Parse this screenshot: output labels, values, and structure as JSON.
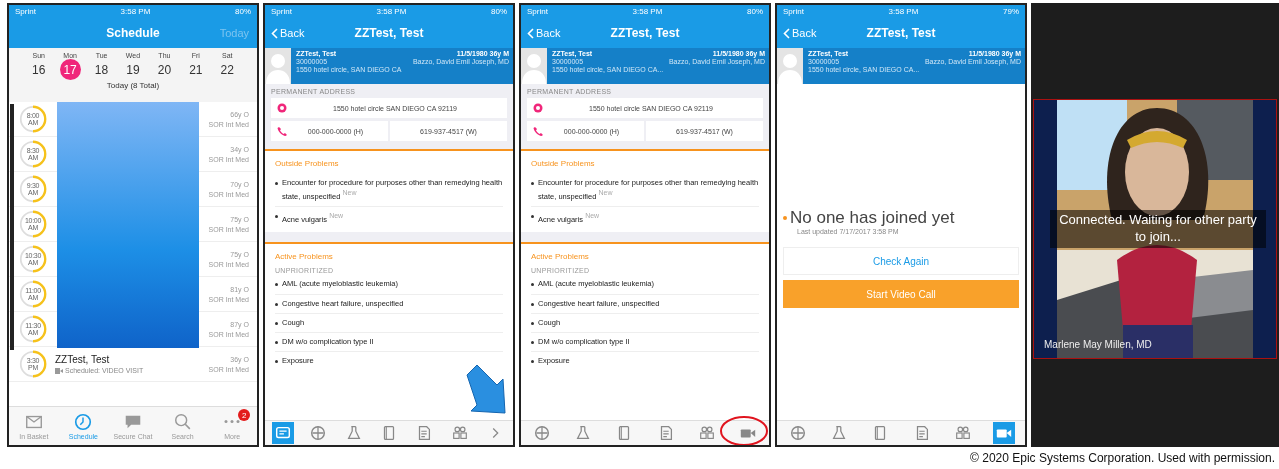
{
  "panels": [
    {
      "kind": "schedule",
      "status": {
        "carrier": "Sprint",
        "time": "3:58 PM",
        "battery": "80%"
      },
      "title": "Schedule",
      "action": "Today",
      "days": [
        {
          "dow": "Sun",
          "date": "16",
          "selected": false
        },
        {
          "dow": "Mon",
          "date": "17",
          "selected": true
        },
        {
          "dow": "Tue",
          "date": "18",
          "selected": false
        },
        {
          "dow": "Wed",
          "date": "19",
          "selected": false
        },
        {
          "dow": "Thu",
          "date": "20",
          "selected": false
        },
        {
          "dow": "Fri",
          "date": "21",
          "selected": false
        },
        {
          "dow": "Sat",
          "date": "22",
          "selected": false
        }
      ],
      "summary": "Today (8 Total)",
      "redacted": true,
      "appointments": [
        {
          "time": "8:00",
          "ampm": "AM",
          "age": "66y O",
          "dept": "SOR Int Med"
        },
        {
          "time": "8:30",
          "ampm": "AM",
          "age": "34y O",
          "dept": "SOR Int Med"
        },
        {
          "time": "9:30",
          "ampm": "AM",
          "age": "70y O",
          "dept": "SOR Int Med"
        },
        {
          "time": "10:00",
          "ampm": "AM",
          "age": "75y O",
          "dept": "SOR Int Med"
        },
        {
          "time": "10:30",
          "ampm": "AM",
          "age": "75y O",
          "dept": "SOR Int Med"
        },
        {
          "time": "11:00",
          "ampm": "AM",
          "age": "81y O",
          "dept": "SOR Int Med"
        },
        {
          "time": "11:30",
          "ampm": "AM",
          "age": "87y O",
          "dept": "SOR Int Med"
        },
        {
          "time": "3:30",
          "ampm": "PM",
          "name": "ZZTest, Test",
          "note": "Scheduled: VIDEO VISIT",
          "age": "36y O",
          "dept": "SOR Int Med"
        }
      ],
      "tabs": [
        {
          "kind": "inbox",
          "label": "In Basket",
          "selected": false
        },
        {
          "kind": "clock",
          "label": "Schedule",
          "selected": true
        },
        {
          "kind": "chat",
          "label": "Secure Chat",
          "selected": false
        },
        {
          "kind": "search",
          "label": "Search",
          "selected": false
        },
        {
          "kind": "more",
          "label": "More",
          "selected": false,
          "badge": "2"
        }
      ]
    },
    {
      "kind": "patient",
      "annotation": {
        "kind": "arrow"
      },
      "status": {
        "carrier": "Sprint",
        "time": "3:58 PM",
        "battery": "80%"
      },
      "back": "Back",
      "title": "ZZTest, Test",
      "patient": {
        "name": "ZZTest, Test",
        "dob": "11/5/1980 36y M",
        "mrn": "30000005",
        "provider": "Bazzo, David Emil Joseph, MD",
        "address": "1550 hotel circle, SAN DIEGO CA"
      },
      "address_label": "PERMANENT ADDRESS",
      "address": "1550 hotel circle SAN DIEGO CA 92119",
      "phone_home": "000-000-0000 (H)",
      "phone_work": "619-937-4517 (W)",
      "outside_title": "Outside Problems",
      "outside": [
        {
          "text": "Encounter for procedure for purposes other than remedying health state, unspecified",
          "tag": "New"
        },
        {
          "text": "Acne vulgaris",
          "tag": "New"
        }
      ],
      "active_title": "Active Problems",
      "active_label": "UNPRIORITIZED",
      "active": [
        "AML (acute myeloblastic leukemia)",
        "Congestive heart failure, unspecified",
        "Cough",
        "DM w/o complication type II",
        "Exposure"
      ],
      "toolbar": [
        {
          "kind": "summary",
          "selected": true
        },
        {
          "kind": "chart",
          "selected": false
        },
        {
          "kind": "labs",
          "selected": false
        },
        {
          "kind": "notes",
          "selected": false
        },
        {
          "kind": "documents",
          "selected": false
        },
        {
          "kind": "team",
          "selected": false
        },
        {
          "kind": "more",
          "selected": false
        }
      ]
    },
    {
      "kind": "patient",
      "annotation": {
        "kind": "ellipse"
      },
      "status": {
        "carrier": "Sprint",
        "time": "3:58 PM",
        "battery": "80%"
      },
      "back": "Back",
      "title": "ZZTest, Test",
      "patient": {
        "name": "ZZTest, Test",
        "dob": "11/5/1980 36y M",
        "mrn": "30000005",
        "provider": "Bazzo, David Emil Joseph, MD",
        "address": "1550 hotel circle, SAN DIEGO CA..."
      },
      "address_label": "PERMANENT ADDRESS",
      "address": "1550 hotel circle SAN DIEGO CA 92119",
      "phone_home": "000-000-0000 (H)",
      "phone_work": "619-937-4517 (W)",
      "outside_title": "Outside Problems",
      "outside": [
        {
          "text": "Encounter for procedure for purposes other than remedying health state, unspecified",
          "tag": "New"
        },
        {
          "text": "Acne vulgaris",
          "tag": "New"
        }
      ],
      "active_title": "Active Problems",
      "active_label": "UNPRIORITIZED",
      "active": [
        "AML (acute myeloblastic leukemia)",
        "Congestive heart failure, unspecified",
        "Cough",
        "DM w/o complication type II",
        "Exposure"
      ],
      "toolbar": [
        {
          "kind": "chart",
          "selected": false
        },
        {
          "kind": "labs",
          "selected": false
        },
        {
          "kind": "notes",
          "selected": false
        },
        {
          "kind": "documents",
          "selected": false
        },
        {
          "kind": "team",
          "selected": false
        },
        {
          "kind": "video",
          "selected": false
        }
      ]
    },
    {
      "kind": "waiting",
      "status": {
        "carrier": "Sprint",
        "time": "3:58 PM",
        "battery": "79%"
      },
      "back": "Back",
      "title": "ZZTest, Test",
      "patient": {
        "name": "ZZTest, Test",
        "dob": "11/5/1980 36y M",
        "mrn": "30000005",
        "provider": "Bazzo, David Emil Joseph, MD",
        "address": "1550 hotel circle, SAN DIEGO CA..."
      },
      "message": "No one has joined yet",
      "updated": "Last updated 7/17/2017 3:58 PM",
      "check_button": "Check Again",
      "start_button": "Start Video Call",
      "toolbar": [
        {
          "kind": "chart",
          "selected": false
        },
        {
          "kind": "labs",
          "selected": false
        },
        {
          "kind": "notes",
          "selected": false
        },
        {
          "kind": "documents",
          "selected": false
        },
        {
          "kind": "team",
          "selected": false
        },
        {
          "kind": "video",
          "selected": true
        }
      ]
    },
    {
      "kind": "video",
      "message": "Connected. Waiting for other party to join...",
      "caller": "Marlene May Millen, MD"
    }
  ],
  "caption": "© 2020 Epic Systems Corporation. Used with permission."
}
